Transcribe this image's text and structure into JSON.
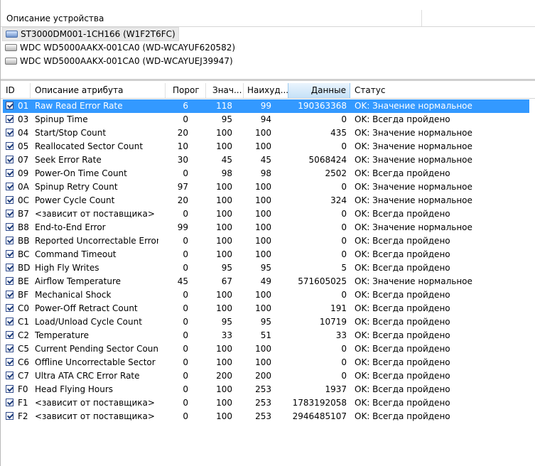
{
  "device_panel": {
    "header": "Описание устройства",
    "devices": [
      {
        "label": "ST3000DM001-1CH166 (W1F2T6FC)",
        "selected": true
      },
      {
        "label": "WDC WD5000AAKX-001CA0 (WD-WCAYUF620582)",
        "selected": false
      },
      {
        "label": "WDC WD5000AAKX-001CA0 (WD-WCAYUEJ39947)",
        "selected": false
      }
    ]
  },
  "attributes": {
    "columns": {
      "id": "ID",
      "name": "Описание атрибута",
      "threshold": "Порог",
      "value": "Знач...",
      "worst": "Наихуд...",
      "raw": "Данные",
      "status": "Статус"
    },
    "sorted_column": "raw",
    "rows": [
      {
        "id": "01",
        "name": "Raw Read Error Rate",
        "threshold": "6",
        "value": "118",
        "worst": "99",
        "raw": "190363368",
        "status": "OK: Значение нормальное",
        "selected": true
      },
      {
        "id": "03",
        "name": "Spinup Time",
        "threshold": "0",
        "value": "95",
        "worst": "94",
        "raw": "0",
        "status": "OK: Всегда пройдено"
      },
      {
        "id": "04",
        "name": "Start/Stop Count",
        "threshold": "20",
        "value": "100",
        "worst": "100",
        "raw": "435",
        "status": "OK: Значение нормальное"
      },
      {
        "id": "05",
        "name": "Reallocated Sector Count",
        "threshold": "10",
        "value": "100",
        "worst": "100",
        "raw": "0",
        "status": "OK: Значение нормальное"
      },
      {
        "id": "07",
        "name": "Seek Error Rate",
        "threshold": "30",
        "value": "45",
        "worst": "45",
        "raw": "5068424",
        "status": "OK: Значение нормальное"
      },
      {
        "id": "09",
        "name": "Power-On Time Count",
        "threshold": "0",
        "value": "98",
        "worst": "98",
        "raw": "2502",
        "status": "OK: Всегда пройдено"
      },
      {
        "id": "0A",
        "name": "Spinup Retry Count",
        "threshold": "97",
        "value": "100",
        "worst": "100",
        "raw": "0",
        "status": "OK: Значение нормальное"
      },
      {
        "id": "0C",
        "name": "Power Cycle Count",
        "threshold": "20",
        "value": "100",
        "worst": "100",
        "raw": "324",
        "status": "OK: Значение нормальное"
      },
      {
        "id": "B7",
        "name": "<зависит от поставщика>",
        "threshold": "0",
        "value": "100",
        "worst": "100",
        "raw": "0",
        "status": "OK: Всегда пройдено"
      },
      {
        "id": "B8",
        "name": "End-to-End Error",
        "threshold": "99",
        "value": "100",
        "worst": "100",
        "raw": "0",
        "status": "OK: Значение нормальное"
      },
      {
        "id": "BB",
        "name": "Reported Uncorrectable Errors",
        "threshold": "0",
        "value": "100",
        "worst": "100",
        "raw": "0",
        "status": "OK: Всегда пройдено"
      },
      {
        "id": "BC",
        "name": "Command Timeout",
        "threshold": "0",
        "value": "100",
        "worst": "100",
        "raw": "0",
        "status": "OK: Всегда пройдено"
      },
      {
        "id": "BD",
        "name": "High Fly Writes",
        "threshold": "0",
        "value": "95",
        "worst": "95",
        "raw": "5",
        "status": "OK: Всегда пройдено"
      },
      {
        "id": "BE",
        "name": "Airflow Temperature",
        "threshold": "45",
        "value": "67",
        "worst": "49",
        "raw": "571605025",
        "status": "OK: Значение нормальное"
      },
      {
        "id": "BF",
        "name": "Mechanical Shock",
        "threshold": "0",
        "value": "100",
        "worst": "100",
        "raw": "0",
        "status": "OK: Всегда пройдено"
      },
      {
        "id": "C0",
        "name": "Power-Off Retract Count",
        "threshold": "0",
        "value": "100",
        "worst": "100",
        "raw": "191",
        "status": "OK: Всегда пройдено"
      },
      {
        "id": "C1",
        "name": "Load/Unload Cycle Count",
        "threshold": "0",
        "value": "95",
        "worst": "95",
        "raw": "10719",
        "status": "OK: Всегда пройдено"
      },
      {
        "id": "C2",
        "name": "Temperature",
        "threshold": "0",
        "value": "33",
        "worst": "51",
        "raw": "33",
        "status": "OK: Всегда пройдено"
      },
      {
        "id": "C5",
        "name": "Current Pending Sector Count",
        "threshold": "0",
        "value": "100",
        "worst": "100",
        "raw": "0",
        "status": "OK: Всегда пройдено"
      },
      {
        "id": "C6",
        "name": "Offline Uncorrectable Sector C...",
        "threshold": "0",
        "value": "100",
        "worst": "100",
        "raw": "0",
        "status": "OK: Всегда пройдено"
      },
      {
        "id": "C7",
        "name": "Ultra ATA CRC Error Rate",
        "threshold": "0",
        "value": "200",
        "worst": "200",
        "raw": "0",
        "status": "OK: Всегда пройдено"
      },
      {
        "id": "F0",
        "name": "Head Flying Hours",
        "threshold": "0",
        "value": "100",
        "worst": "253",
        "raw": "1937",
        "status": "OK: Всегда пройдено"
      },
      {
        "id": "F1",
        "name": "<зависит от поставщика>",
        "threshold": "0",
        "value": "100",
        "worst": "253",
        "raw": "1783192058",
        "status": "OK: Всегда пройдено"
      },
      {
        "id": "F2",
        "name": "<зависит от поставщика>",
        "threshold": "0",
        "value": "100",
        "worst": "253",
        "raw": "2946485107",
        "status": "OK: Всегда пройдено"
      }
    ]
  },
  "colors": {
    "selection": "#3399ff",
    "sorted_header": "#c5e1f7",
    "checkbox_border": "#2f4a8b"
  }
}
